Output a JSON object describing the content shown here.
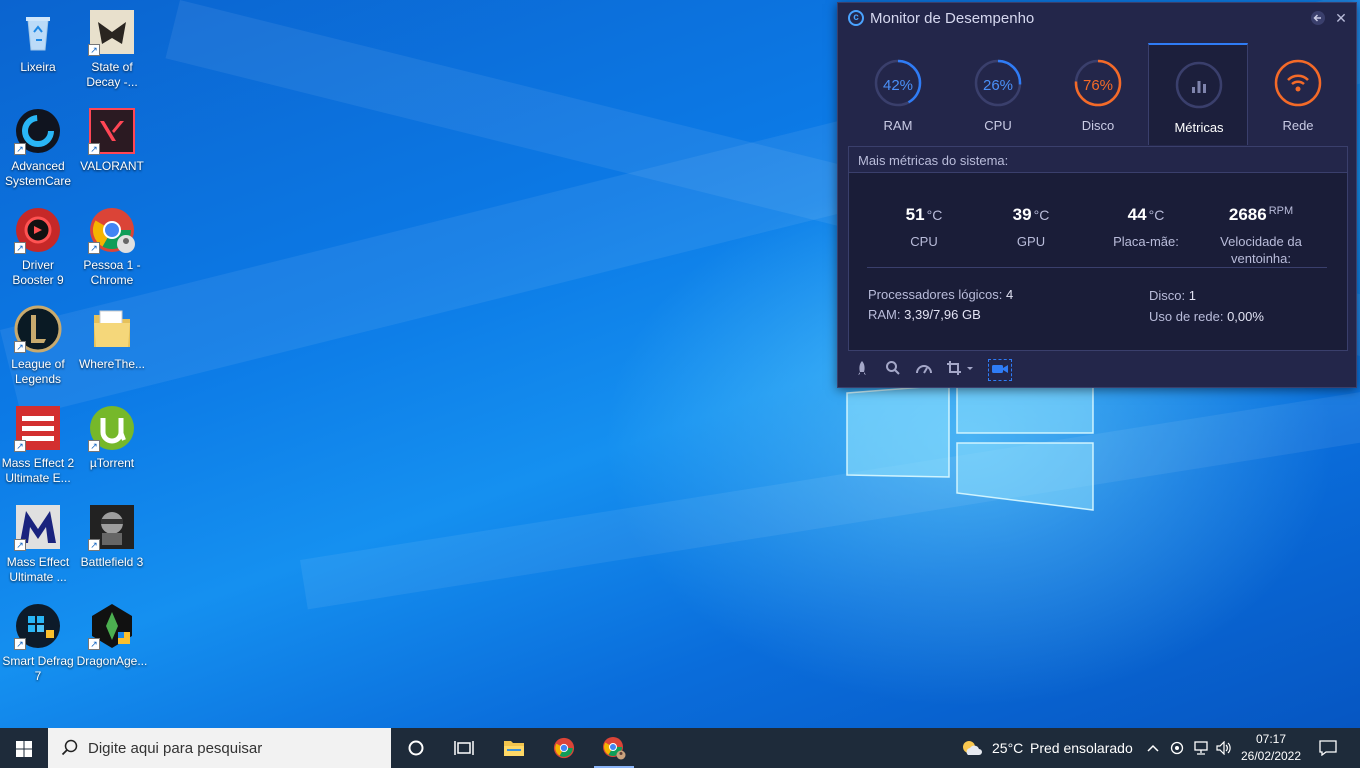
{
  "desktop": {
    "icons": [
      {
        "label": "Lixeira"
      },
      {
        "label": "State of Decay -..."
      },
      {
        "label": "Advanced SystemCare"
      },
      {
        "label": "VALORANT"
      },
      {
        "label": "Driver Booster 9"
      },
      {
        "label": "Pessoa 1 - Chrome"
      },
      {
        "label": "League of Legends"
      },
      {
        "label": "WhereThe..."
      },
      {
        "label": "Mass Effect 2 Ultimate E..."
      },
      {
        "label": "µTorrent"
      },
      {
        "label": "Mass Effect Ultimate ..."
      },
      {
        "label": "Battlefield 3"
      },
      {
        "label": "Smart Defrag 7"
      },
      {
        "label": "DragonAge..."
      }
    ]
  },
  "monitor": {
    "title": "Monitor de Desempenho",
    "accent": "#2f7cf6",
    "orange": "#f46a28",
    "tabs": [
      {
        "label": "RAM",
        "pct": "42%",
        "value": 42
      },
      {
        "label": "CPU",
        "pct": "26%",
        "value": 26
      },
      {
        "label": "Disco",
        "pct": "76%",
        "value": 76
      },
      {
        "label": "Métricas"
      },
      {
        "label": "Rede"
      }
    ],
    "panel_title": "Mais métricas do sistema:",
    "metrics": [
      {
        "value": "51",
        "unit": "°C",
        "name": "CPU"
      },
      {
        "value": "39",
        "unit": "°C",
        "name": "GPU"
      },
      {
        "value": "44",
        "unit": "°C",
        "name": "Placa-mãe:"
      },
      {
        "value": "2686",
        "unit": "RPM",
        "name": "Velocidade da ventoinha:"
      }
    ],
    "info": {
      "logical_label": "Processadores lógicos:",
      "logical_value": "4",
      "ram_label": "RAM:",
      "ram_value": "3,39/7,96 GB",
      "disk_label": "Disco:",
      "disk_value": "1",
      "net_label": "Uso de rede:",
      "net_value": "0,00%"
    }
  },
  "taskbar": {
    "search_placeholder": "Digite aqui para pesquisar",
    "weather_temp": "25°C",
    "weather_desc": "Pred ensolarado",
    "time": "07:17",
    "date": "26/02/2022"
  }
}
